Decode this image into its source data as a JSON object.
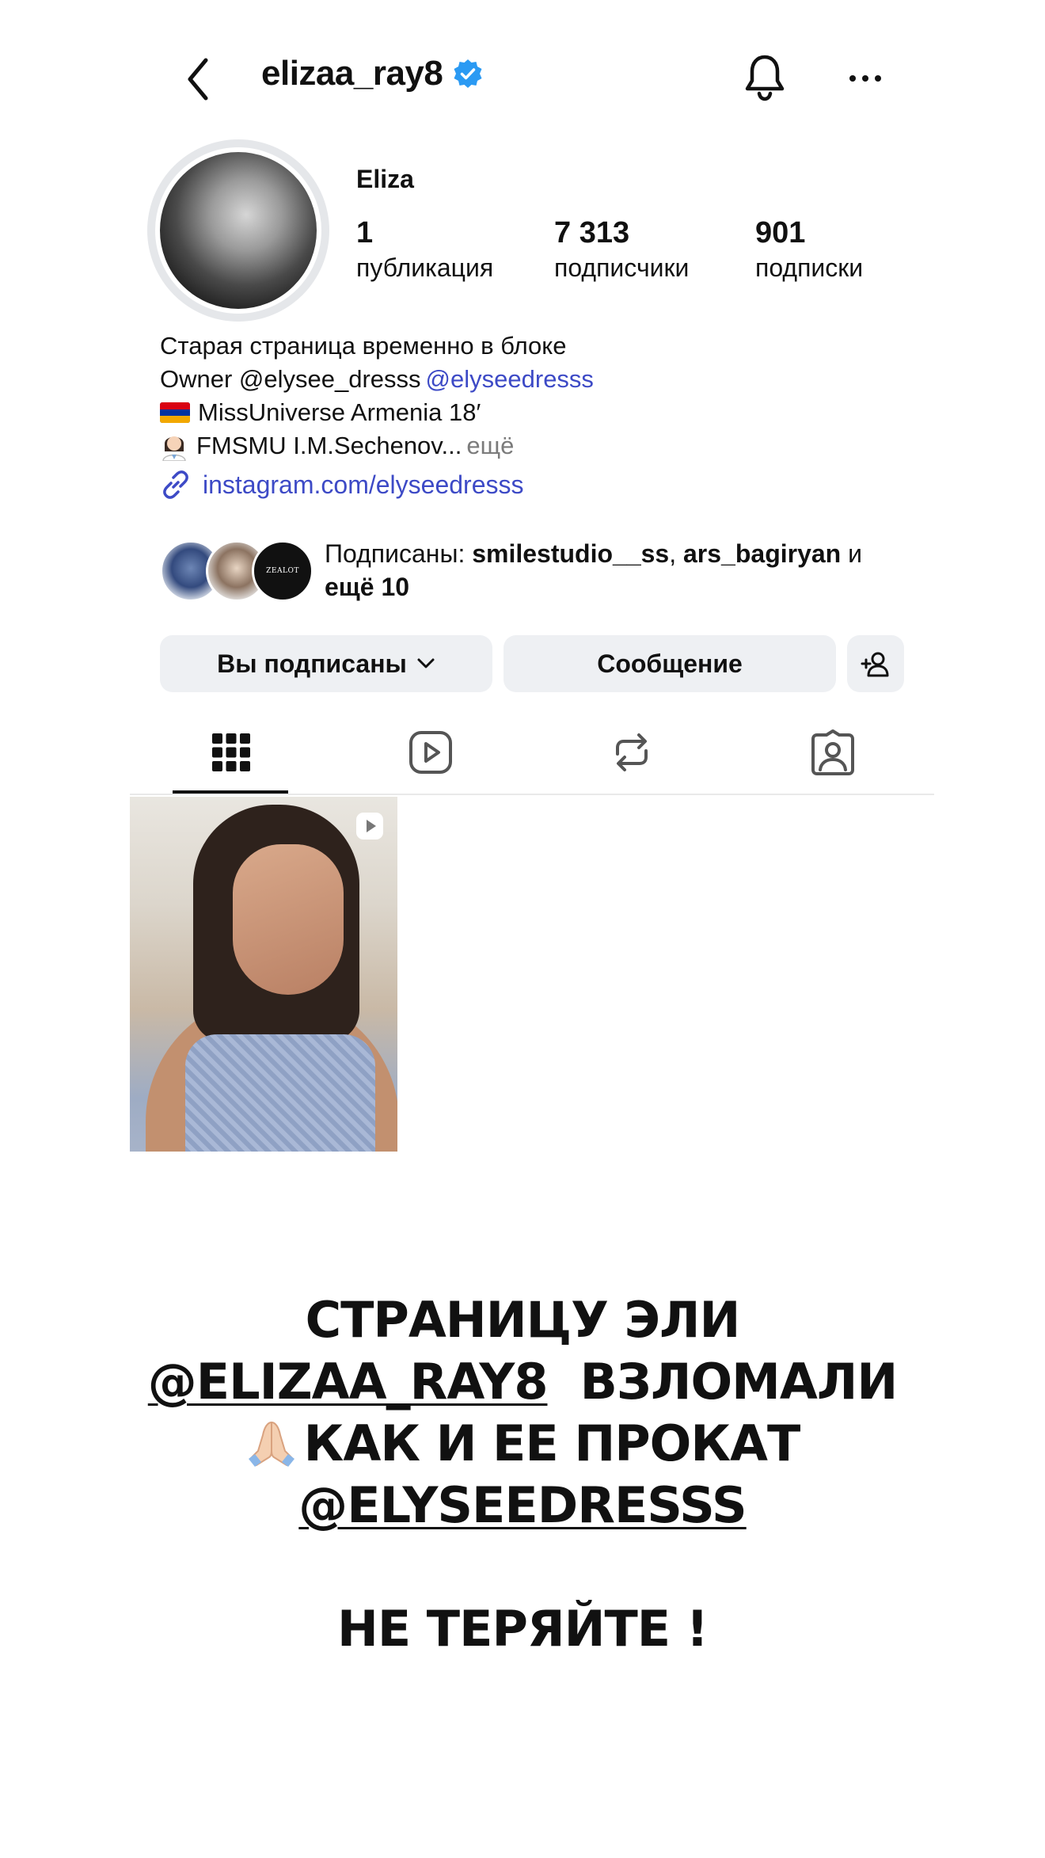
{
  "header": {
    "username": "elizaa_ray8"
  },
  "profile": {
    "display_name": "Eliza",
    "stats": [
      {
        "value": "1",
        "label": "публикация"
      },
      {
        "value": "7 313",
        "label": "подписчики"
      },
      {
        "value": "901",
        "label": "подписки"
      }
    ],
    "bio": {
      "line1": "Старая страница временно в блоке",
      "line2_prefix": "Owner @elysee_dresss",
      "line2_mention": "@elyseedresss",
      "line3": "MissUniverse Armenia 18′",
      "line4": "FMSMU I.M.Sechenov...",
      "more": "ещё"
    },
    "link": "instagram.com/elyseedresss",
    "followed_by": {
      "prefix": "Подписаны: ",
      "user1": "smilestudio__ss",
      "sep": ", ",
      "user2": "ars_bagiryan",
      "and": " и",
      "more": "ещё 10",
      "avatar3_text": "ZEALOT"
    }
  },
  "actions": {
    "following_label": "Вы подписаны",
    "message_label": "Сообщение"
  },
  "tabs": [
    {
      "icon": "grid-icon",
      "active": true
    },
    {
      "icon": "reels-icon",
      "active": false
    },
    {
      "icon": "reposts-icon",
      "active": false
    },
    {
      "icon": "tagged-icon",
      "active": false
    }
  ],
  "overlay": {
    "line1": "СТРАНИЦУ ЭЛИ",
    "line2_handle": "@ELIZAA_RAY8",
    "line2_rest": "  ВЗЛОМАЛИ",
    "line3": "КАК И ЕЕ ПРОКАТ",
    "line4_handle": "@ELYSEEDRESSS",
    "line5": "НЕ ТЕРЯЙТЕ !"
  },
  "colors": {
    "link": "#3d4ac6",
    "verified": "#2b9af3",
    "button_bg": "#eef0f3"
  }
}
